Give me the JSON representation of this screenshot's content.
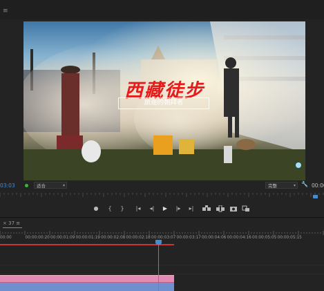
{
  "program_monitor": {
    "title_text": "西藏徒步",
    "subtitle_text": "旅途的朝拜者",
    "timecode": "03:03",
    "fit_label": "适合",
    "resolution_label": "完整",
    "duration_partial": "00:00"
  },
  "transport": {
    "marker": "●",
    "in": "{",
    "out": "}",
    "go_in": "|◂",
    "step_back": "◂|",
    "play": "▶",
    "step_fwd": "|▸",
    "go_out": "▸|"
  },
  "timeline": {
    "tab_label": "37 ≡",
    "ruler_labels": [
      "00:00",
      "00:00:00:20",
      "00:00:01:09",
      "00:00:01:19",
      "00:00:02:08",
      "00:00:02:18",
      "00:00:03:07",
      "00:00:03:17",
      "00:00:04:06",
      "00:00:04:16",
      "00:00:05:05",
      "00:00:05:15"
    ]
  },
  "colors": {
    "accent": "#3f8ed8",
    "title_red": "#e81b1b",
    "clip_pink": "#e58ab2",
    "clip_blue": "#6f8fcf"
  }
}
